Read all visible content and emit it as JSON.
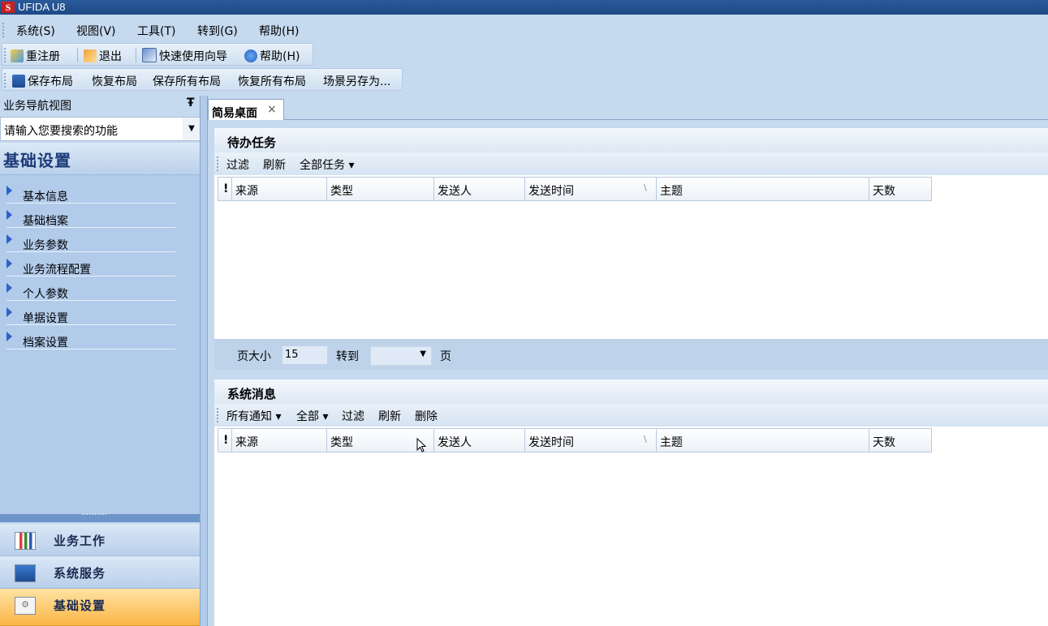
{
  "app": {
    "title": "UFIDA U8",
    "logo_text": "S"
  },
  "menu": [
    "系统(S)",
    "视图(V)",
    "工具(T)",
    "转到(G)",
    "帮助(H)"
  ],
  "toolbar1": {
    "relogin": "重注册",
    "exit": "退出",
    "wizard": "快速使用向导",
    "help": "帮助(H)"
  },
  "toolbar2": {
    "save_layout": "保存布局",
    "restore_layout": "恢复布局",
    "save_all_layouts": "保存所有布局",
    "restore_all_layouts": "恢复所有布局",
    "save_scene_as": "场景另存为..."
  },
  "nav": {
    "header": "业务导航视图",
    "pin": "Ŧ",
    "search_placeholder": "请输入您要搜索的功能",
    "title": "基础设置",
    "items": [
      "基本信息",
      "基础档案",
      "业务参数",
      "业务流程配置",
      "个人参数",
      "单据设置",
      "档案设置"
    ],
    "splitter_dots": "··········",
    "buttons": [
      "业务工作",
      "系统服务",
      "基础设置"
    ]
  },
  "tabs": [
    {
      "label": "简易桌面",
      "close": "×"
    }
  ],
  "todo": {
    "title": "待办任务",
    "actions": {
      "filter": "过滤",
      "refresh": "刷新",
      "all_tasks": "全部任务 ▾"
    },
    "columns": [
      "!",
      "来源",
      "类型",
      "发送人",
      "发送时间",
      "主题",
      "天数"
    ],
    "sort_mark": "\\",
    "pager": {
      "page_size_label": "页大小",
      "page_size": "15",
      "goto_label": "转到",
      "page_label": "页"
    }
  },
  "messages": {
    "title": "系统消息",
    "actions": {
      "all_notices": "所有通知 ▾",
      "all": "全部 ▾",
      "filter": "过滤",
      "refresh": "刷新",
      "delete": "删除"
    },
    "columns": [
      "!",
      "来源",
      "类型",
      "发送人",
      "发送时间",
      "主题",
      "天数"
    ],
    "sort_mark": "\\"
  },
  "colors": {
    "accent": "#fbb547",
    "nav_bg": "#b2cbea",
    "titlebar": "#1d4a86"
  }
}
